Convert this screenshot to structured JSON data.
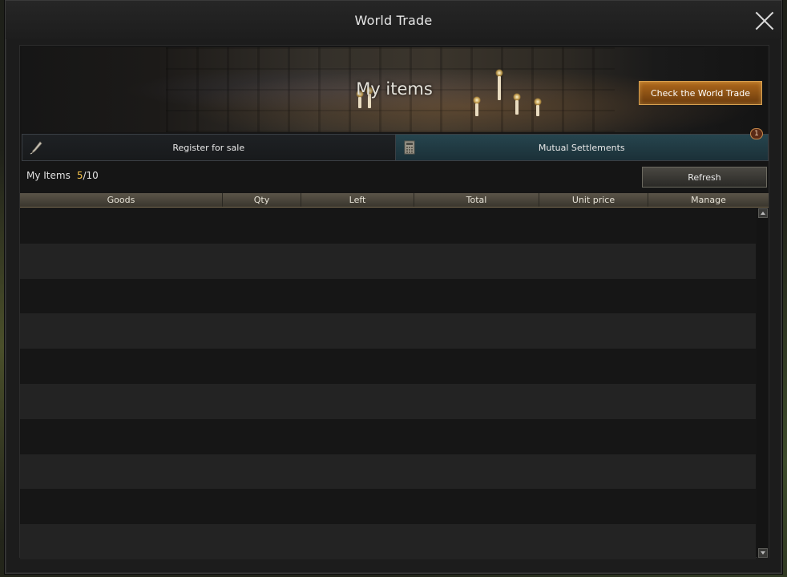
{
  "window": {
    "title": "World Trade"
  },
  "banner": {
    "title": "My items",
    "check_button_label": "Check the World Trade"
  },
  "tabs": [
    {
      "label": "Register for sale",
      "icon": "quill-icon",
      "active": false
    },
    {
      "label": "Mutual Settlements",
      "icon": "calculator-icon",
      "active": true,
      "badge": "1"
    }
  ],
  "summary": {
    "label": "My Items",
    "current": "5",
    "max": "/10"
  },
  "refresh_label": "Refresh",
  "table": {
    "columns": [
      "Goods",
      "Qty",
      "Left",
      "Total",
      "Unit price",
      "Manage"
    ],
    "rows": []
  },
  "colors": {
    "accent_orange": "#b06a1c",
    "count_highlight": "#f2c14a",
    "active_tab": "#26454e"
  }
}
